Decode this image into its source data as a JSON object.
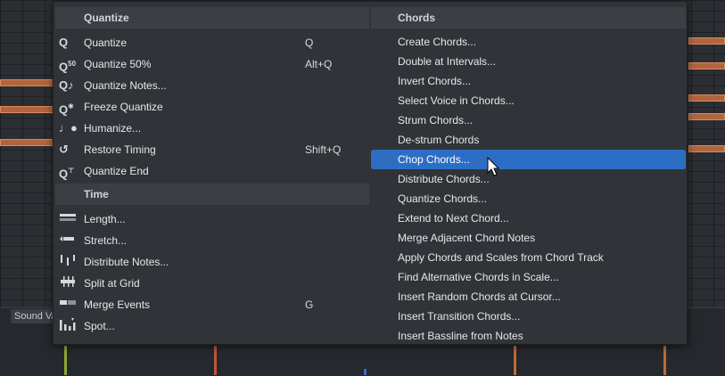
{
  "background": {
    "sound_tab_label": "Sound Va"
  },
  "menu": {
    "left": {
      "sections": [
        {
          "title": "Quantize",
          "items": [
            {
              "label": "Quantize",
              "shortcut": "Q",
              "icon": "quantize-icon"
            },
            {
              "label": "Quantize 50%",
              "shortcut": "Alt+Q",
              "icon": "quantize-50-icon"
            },
            {
              "label": "Quantize Notes...",
              "shortcut": "",
              "icon": "quantize-notes-icon"
            },
            {
              "label": "Freeze Quantize",
              "shortcut": "",
              "icon": "freeze-quantize-icon"
            },
            {
              "label": "Humanize...",
              "shortcut": "",
              "icon": "humanize-icon"
            },
            {
              "label": "Restore Timing",
              "shortcut": "Shift+Q",
              "icon": "restore-timing-icon"
            },
            {
              "label": "Quantize End",
              "shortcut": "",
              "icon": "quantize-end-icon"
            }
          ]
        },
        {
          "title": "Time",
          "items": [
            {
              "label": "Length...",
              "shortcut": "",
              "icon": "length-icon"
            },
            {
              "label": "Stretch...",
              "shortcut": "",
              "icon": "stretch-icon"
            },
            {
              "label": "Distribute Notes...",
              "shortcut": "",
              "icon": "distribute-notes-icon"
            },
            {
              "label": "Split at Grid",
              "shortcut": "",
              "icon": "split-at-grid-icon"
            },
            {
              "label": "Merge Events",
              "shortcut": "G",
              "icon": "merge-events-icon"
            },
            {
              "label": "Spot...",
              "shortcut": "",
              "icon": "spot-icon"
            }
          ]
        }
      ]
    },
    "right": {
      "title": "Chords",
      "highlighted_index": 6,
      "items": [
        "Create Chords...",
        "Double at Intervals...",
        "Invert Chords...",
        "Select Voice in Chords...",
        "Strum Chords...",
        "De-strum Chords",
        "Chop Chords...",
        "Distribute Chords...",
        "Quantize Chords...",
        "Extend to Next Chord...",
        "Merge Adjacent Chord Notes",
        "Apply Chords and Scales from Chord Track",
        "Find Alternative Chords in Scale...",
        "Insert Random Chords at Cursor...",
        "Insert Transition Chords...",
        "Insert Bassline from Notes"
      ]
    },
    "colors": {
      "highlight": "#2d6ec4",
      "menu_bg": "#303337",
      "header_bg": "#3b3f44"
    }
  }
}
